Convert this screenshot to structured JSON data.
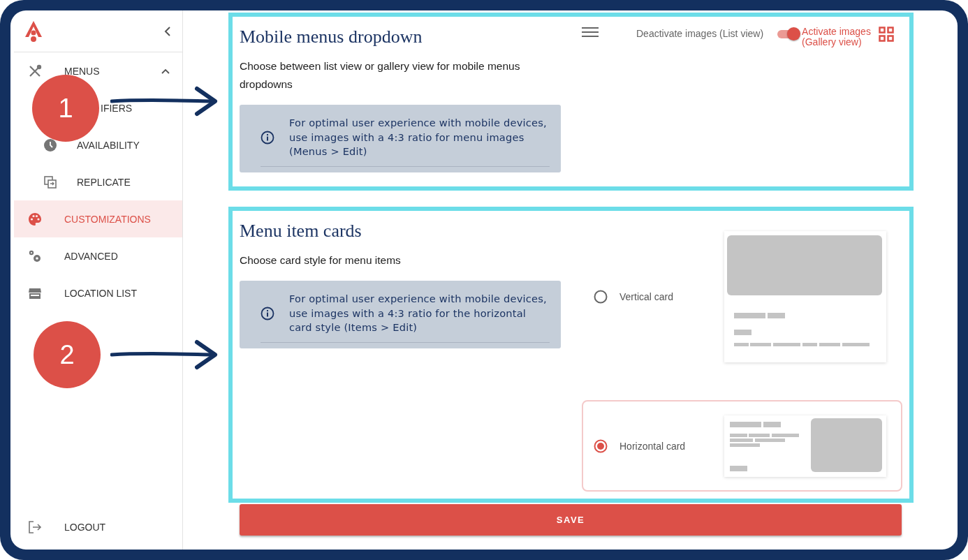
{
  "sidebar": {
    "items": [
      {
        "label": "MENUS",
        "selected": false,
        "expanded": true,
        "children": [
          {
            "label": "IFIERS",
            "selected": false
          },
          {
            "label": "AVAILABILITY",
            "selected": false
          },
          {
            "label": "REPLICATE",
            "selected": false
          }
        ]
      },
      {
        "label": "CUSTOMIZATIONS",
        "selected": true
      },
      {
        "label": "ADVANCED",
        "selected": false
      },
      {
        "label": "LOCATION LIST",
        "selected": false
      }
    ],
    "logout": "LOGOUT"
  },
  "sections": [
    {
      "title": "Mobile menus dropdown",
      "description": "Choose between list view or gallery view for mobile menus dropdowns",
      "info": "For optimal user experience with mobile devices, use images with a 4:3 ratio for menu images (Menus > Edit)",
      "toggle": {
        "off_label": "Deactivate images (List view)",
        "on_label": "Activate images (Gallery view)",
        "on": true
      }
    },
    {
      "title": "Menu item cards",
      "description": "Choose card style for menu items",
      "info": "For optimal user experience with mobile devices, use images with a 4:3 ratio for the horizontal card style (Items > Edit)",
      "options": [
        {
          "label": "Vertical card",
          "kind": "vertical",
          "selected": false
        },
        {
          "label": "Horizontal card",
          "kind": "horizontal",
          "selected": true
        }
      ]
    }
  ],
  "save_button": "SAVE",
  "annotations": [
    {
      "label": "1"
    },
    {
      "label": "2"
    }
  ]
}
